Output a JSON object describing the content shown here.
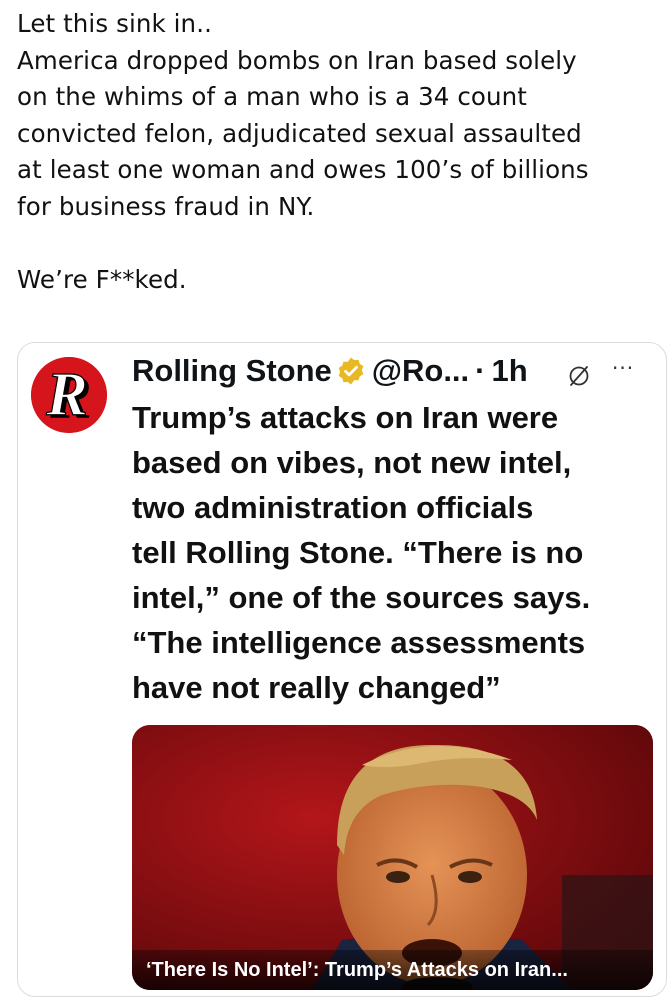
{
  "post": {
    "lines": [
      "Let this sink in..",
      "America dropped bombs on Iran based solely",
      "on the whims of a man who is a 34 count",
      "convicted felon, adjudicated sexual assaulted",
      "at least one woman and owes 100’s of billions",
      "for business fraud in NY."
    ],
    "closing": "We’re F**ked."
  },
  "quote": {
    "avatar_letter": "R",
    "author_name": "Rolling Stone",
    "handle": "@Ro...",
    "separator": "·",
    "time": "1h",
    "more": "···",
    "body_lines": [
      "Trump’s attacks on Iran were",
      "based on vibes, not new intel,",
      "two administration officials",
      "tell Rolling Stone. “There is no",
      "intel,” one of the sources says.",
      "“The intelligence assessments",
      "have not really changed”"
    ],
    "media_caption": "‘There Is No Intel’: Trump’s Attacks on Iran..."
  },
  "colors": {
    "avatar_red": "#d6141b",
    "verified_gold": "#e8b923",
    "card_border": "#d8dde2"
  },
  "icons": {
    "verified": "verified-badge-icon",
    "grok": "grok-icon",
    "more": "more-icon"
  }
}
